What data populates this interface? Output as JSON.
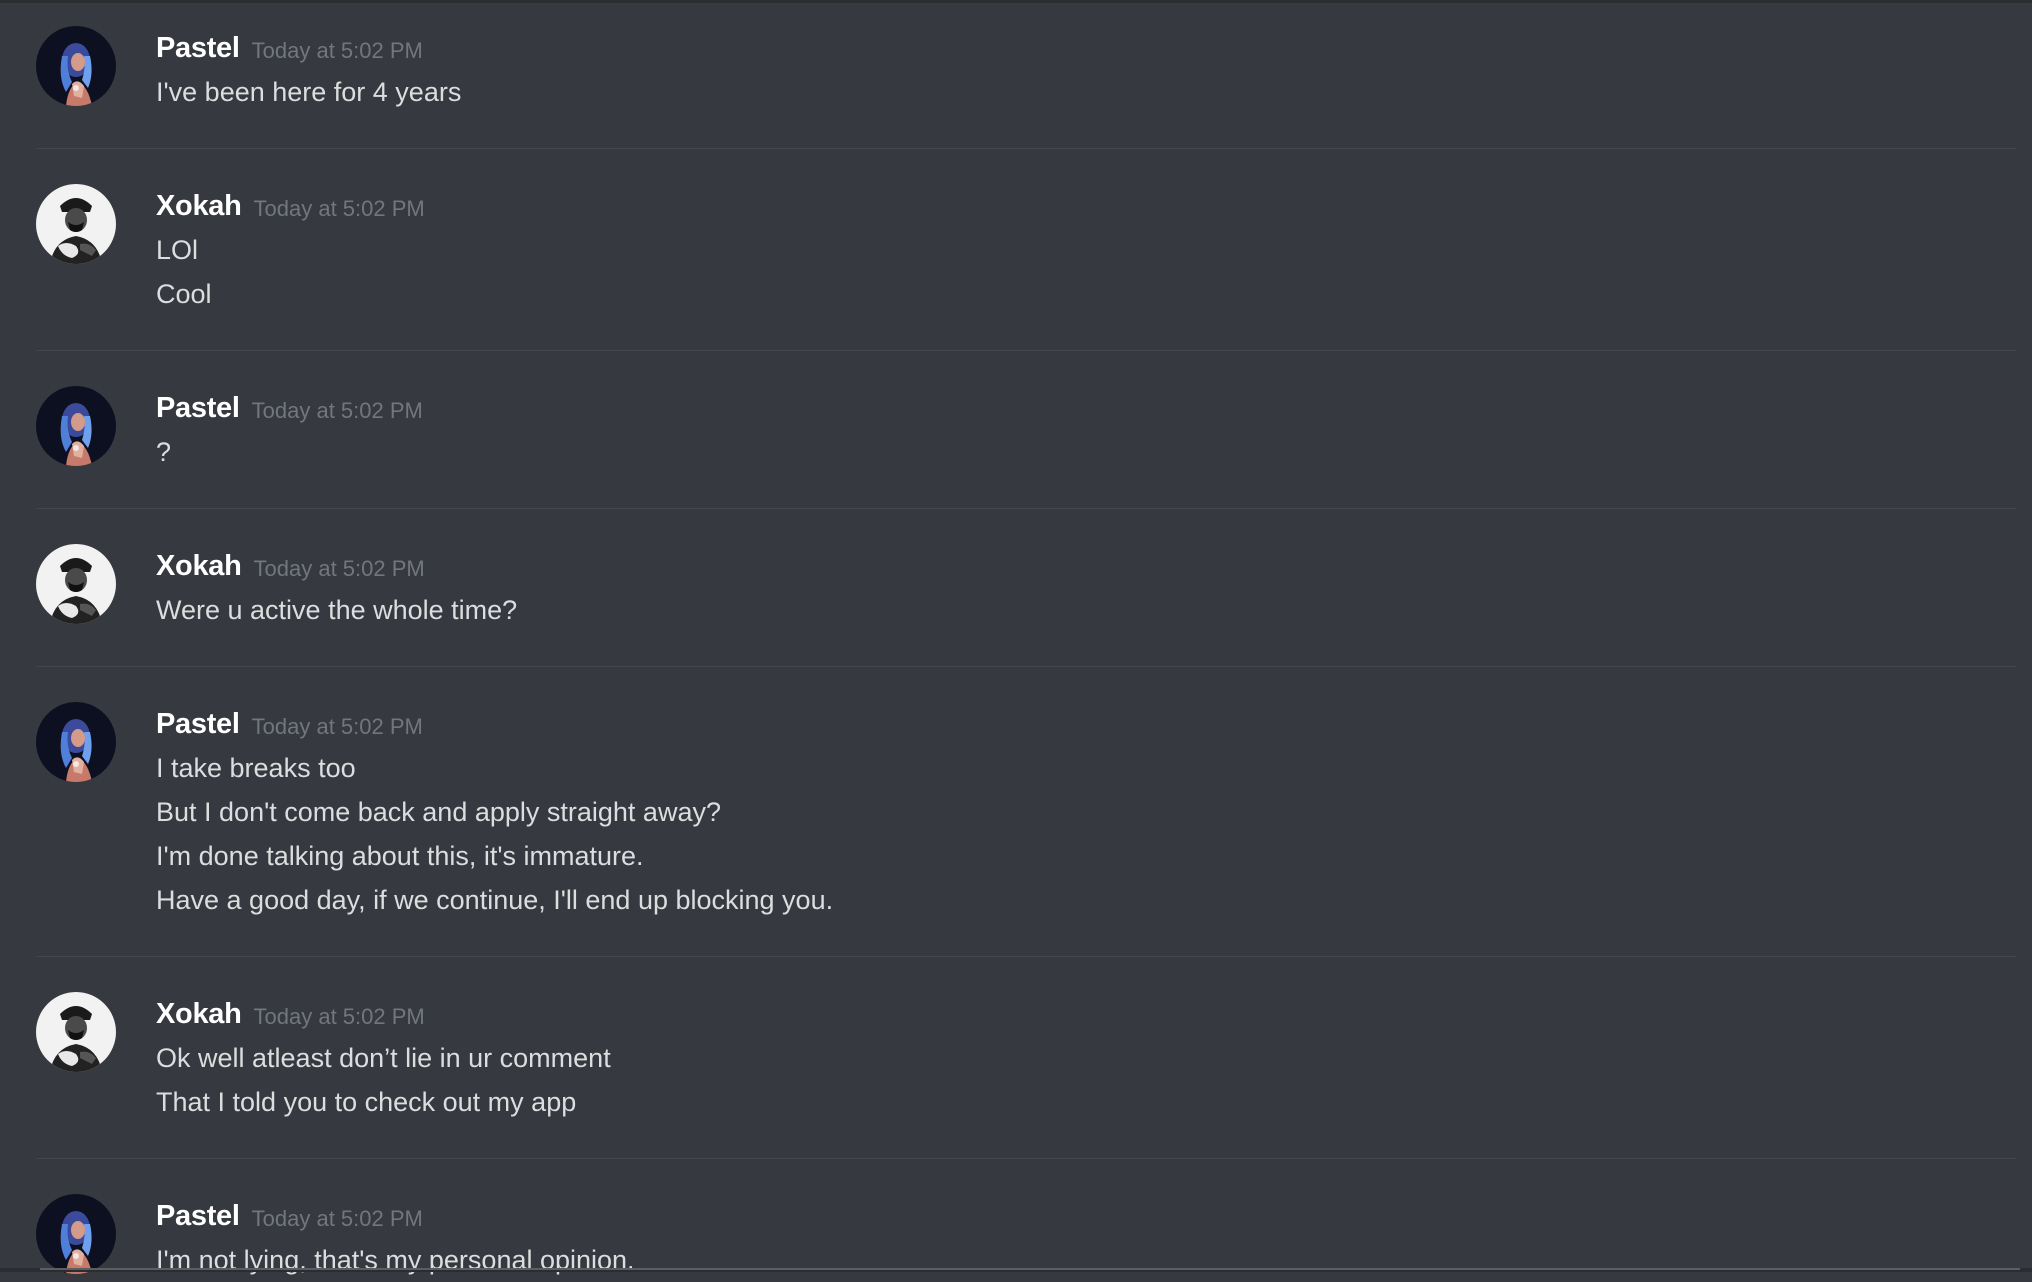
{
  "messages": [
    {
      "author": "Pastel",
      "avatar_icon": "pastel-avatar-icon",
      "timestamp": "Today at 5:02 PM",
      "lines": [
        "I've been here for 4 years"
      ]
    },
    {
      "author": "Xokah",
      "avatar_icon": "xokah-avatar-icon",
      "timestamp": "Today at 5:02 PM",
      "lines": [
        "LOl",
        "Cool"
      ]
    },
    {
      "author": "Pastel",
      "avatar_icon": "pastel-avatar-icon",
      "timestamp": "Today at 5:02 PM",
      "lines": [
        "?"
      ]
    },
    {
      "author": "Xokah",
      "avatar_icon": "xokah-avatar-icon",
      "timestamp": "Today at 5:02 PM",
      "lines": [
        "Were u active the whole time?"
      ]
    },
    {
      "author": "Pastel",
      "avatar_icon": "pastel-avatar-icon",
      "timestamp": "Today at 5:02 PM",
      "lines": [
        "I take breaks too",
        "But I don't come back and apply straight away?",
        "I'm done talking about this, it's immature.",
        "Have a good day, if we continue, I'll end up blocking you."
      ]
    },
    {
      "author": "Xokah",
      "avatar_icon": "xokah-avatar-icon",
      "timestamp": "Today at 5:02 PM",
      "lines": [
        "Ok well atleast don’t lie in ur comment",
        "That I told you to check out my app"
      ]
    },
    {
      "author": "Pastel",
      "avatar_icon": "pastel-avatar-icon",
      "timestamp": "Today at 5:02 PM",
      "lines": [
        "I'm not lying, that's my personal opinion."
      ]
    }
  ],
  "colors": {
    "background": "#36393f",
    "username": "#ffffff",
    "timestamp": "#72767d",
    "message_text": "#dcddde",
    "divider": "#42454c"
  }
}
